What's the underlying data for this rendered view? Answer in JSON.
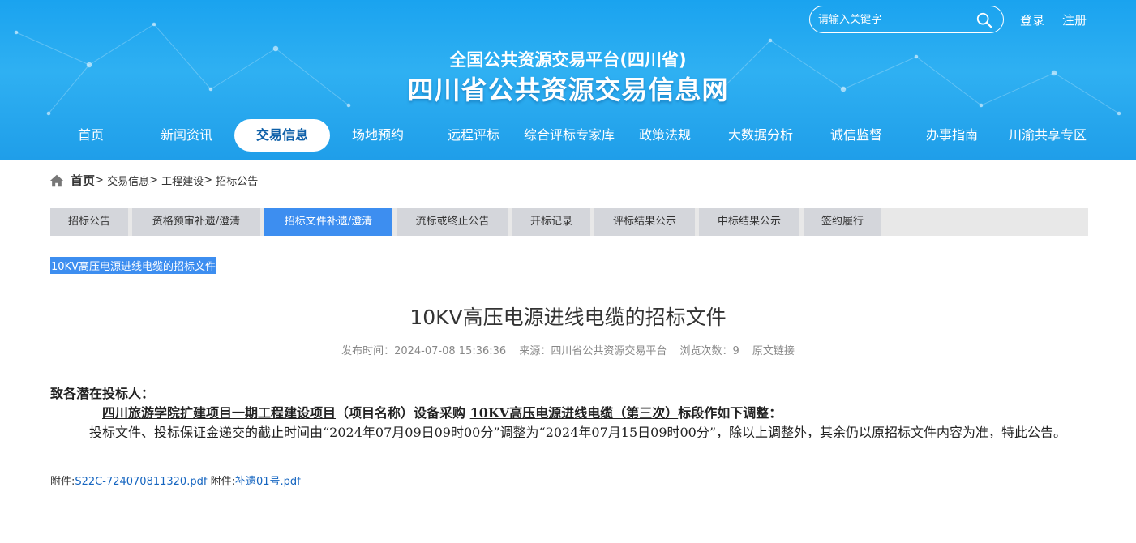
{
  "header": {
    "platform_name": "全国公共资源交易平台(四川省)",
    "site_name": "四川省公共资源交易信息网",
    "search_placeholder": "请输入关键字",
    "login": "登录",
    "register": "注册"
  },
  "nav": {
    "items": [
      "首页",
      "新闻资讯",
      "交易信息",
      "场地预约",
      "远程评标",
      "综合评标专家库",
      "政策法规",
      "大数据分析",
      "诚信监督",
      "办事指南",
      "川渝共享专区"
    ],
    "active": "交易信息"
  },
  "breadcrumb": {
    "home": "首页",
    "sep": ">",
    "items": [
      "交易信息",
      "工程建设",
      "招标公告"
    ]
  },
  "tabs": {
    "items": [
      "招标公告",
      "资格预审补遗/澄清",
      "招标文件补遗/澄清",
      "流标或终止公告",
      "开标记录",
      "评标结果公示",
      "中标结果公示",
      "签约履行"
    ],
    "active": "招标文件补遗/澄清"
  },
  "selected_title": "10KV高压电源进线电缆的招标文件",
  "article": {
    "title": "10KV高压电源进线电缆的招标文件",
    "publish_time": "发布时间：2024-07-08 15:36:36",
    "source": "来源：四川省公共资源交易平台",
    "views": "浏览次数：9",
    "original_link": "原文链接",
    "greeting": "致各潜在投标人：",
    "adjust_project": "四川旅游学院扩建项目一期工程建设项目",
    "adjust_mid": "（项目名称）设备采购",
    "adjust_section": "10KV高压电源进线电缆（第三次）",
    "adjust_end": "标段作如下调整：",
    "paragraph": "投标文件、投标保证金递交的截止时间由“2024年07月09日09时00分”调整为“2024年07月15日09时00分”，除以上调整外，其余仍以原招标文件内容为准，特此公告。"
  },
  "attachments": {
    "label": "附件:",
    "files": [
      "S22C-724070811320.pdf",
      "补遗01号.pdf"
    ]
  },
  "colors": {
    "header_blue": "#1aa3ef",
    "tab_active": "#3d8ef0",
    "link": "#1565c0"
  }
}
